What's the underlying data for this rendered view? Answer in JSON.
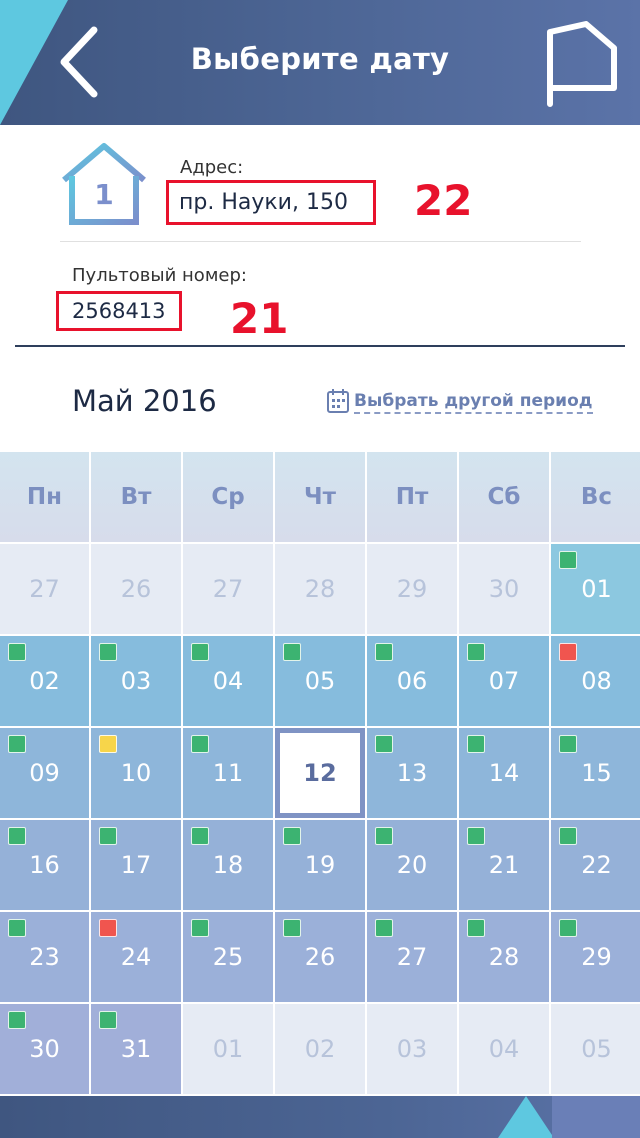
{
  "header": {
    "title": "Выберите дату",
    "back_icon": "chevron-left-icon",
    "flag_icon": "flag-icon"
  },
  "house": {
    "number": "1"
  },
  "address": {
    "label": "Адрес:",
    "value": "пр. Науки, 150",
    "annotation": "22"
  },
  "pult": {
    "label": "Пультовый номер:",
    "value": "2568413",
    "annotation": "21"
  },
  "month_title": "Май 2016",
  "period_link": "Выбрать другой период",
  "weekdays": [
    "Пн",
    "Вт",
    "Ср",
    "Чт",
    "Пт",
    "Сб",
    "Вс"
  ],
  "colors": {
    "green": "#3cb371",
    "red": "#f0554f",
    "yellow": "#f7d54a",
    "annotation_red": "#e8122c"
  },
  "days": [
    {
      "d": "27",
      "out": true
    },
    {
      "d": "26",
      "out": true
    },
    {
      "d": "27",
      "out": true
    },
    {
      "d": "28",
      "out": true
    },
    {
      "d": "29",
      "out": true
    },
    {
      "d": "30",
      "out": true
    },
    {
      "d": "01",
      "mark": "green"
    },
    {
      "d": "02",
      "mark": "green"
    },
    {
      "d": "03",
      "mark": "green"
    },
    {
      "d": "04",
      "mark": "green"
    },
    {
      "d": "05",
      "mark": "green"
    },
    {
      "d": "06",
      "mark": "green"
    },
    {
      "d": "07",
      "mark": "green"
    },
    {
      "d": "08",
      "mark": "red"
    },
    {
      "d": "09",
      "mark": "green"
    },
    {
      "d": "10",
      "mark": "yellow"
    },
    {
      "d": "11",
      "mark": "green"
    },
    {
      "d": "12",
      "selected": true
    },
    {
      "d": "13",
      "mark": "green"
    },
    {
      "d": "14",
      "mark": "green"
    },
    {
      "d": "15",
      "mark": "green"
    },
    {
      "d": "16",
      "mark": "green"
    },
    {
      "d": "17",
      "mark": "green"
    },
    {
      "d": "18",
      "mark": "green"
    },
    {
      "d": "19",
      "mark": "green"
    },
    {
      "d": "20",
      "mark": "green"
    },
    {
      "d": "21",
      "mark": "green"
    },
    {
      "d": "22",
      "mark": "green"
    },
    {
      "d": "23",
      "mark": "green"
    },
    {
      "d": "24",
      "mark": "red"
    },
    {
      "d": "25",
      "mark": "green"
    },
    {
      "d": "26",
      "mark": "green"
    },
    {
      "d": "27",
      "mark": "green"
    },
    {
      "d": "28",
      "mark": "green"
    },
    {
      "d": "29",
      "mark": "green"
    },
    {
      "d": "30",
      "mark": "green"
    },
    {
      "d": "31",
      "mark": "green"
    },
    {
      "d": "01",
      "out": true
    },
    {
      "d": "02",
      "out": true
    },
    {
      "d": "03",
      "out": true
    },
    {
      "d": "04",
      "out": true
    },
    {
      "d": "05",
      "out": true
    }
  ]
}
